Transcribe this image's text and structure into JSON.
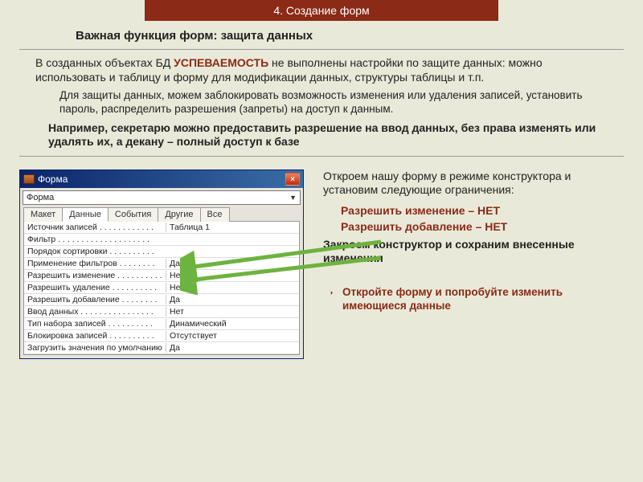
{
  "header": {
    "title": "4. Создание форм"
  },
  "title": "Важная функция форм: защита данных",
  "para1_a": "В созданных объектах БД ",
  "para1_hl": "УСПЕВАЕМОСТЬ",
  "para1_b": " не выполнены настройки по защите данных: можно использовать и таблицу и форму для модификации данных, структуры таблицы и т.п.",
  "para2": "Для защиты данных, можем заблокировать возможность изменения или удаления записей, установить пароль, распределить разрешения (запреты) на доступ к данным.",
  "para3": "Например, секретарю можно предоставить разрешение на ввод данных, без права изменять или удалять их, а декану – полный доступ к базе",
  "right": {
    "line1": "Откроем нашу форму в режиме конструктора и установим следующие ограничения:",
    "opt1": "Разрешить изменение – НЕТ",
    "opt2": "Разрешить добавление – НЕТ",
    "line2": "Закроем конструктор и сохраним внесенные изменения",
    "note": "Откройте форму и попробуйте изменить имеющиеся данные"
  },
  "window": {
    "title": "Форма",
    "close": "×",
    "dropdown_value": "Форма",
    "tabs": [
      "Макет",
      "Данные",
      "События",
      "Другие",
      "Все"
    ],
    "active_tab": 1,
    "props": [
      {
        "label": "Источник записей . . . . . . . . . . . .",
        "value": "Таблица 1"
      },
      {
        "label": "Фильтр . . . . . . . . . . . . . . . . . . . .",
        "value": ""
      },
      {
        "label": "Порядок сортировки . . . . . . . . . .",
        "value": ""
      },
      {
        "label": "Применение фильтров . . . . . . . .",
        "value": "Да"
      },
      {
        "label": "Разрешить изменение . . . . . . . . . .",
        "value": "Нет"
      },
      {
        "label": "Разрешить удаление . . . . . . . . . .",
        "value": "Нет"
      },
      {
        "label": "Разрешить добавление . . . . . . . .",
        "value": "Да"
      },
      {
        "label": "Ввод данных . . . . . . . . . . . . . . . .",
        "value": "Нет"
      },
      {
        "label": "Тип набора записей . . . . . . . . . .",
        "value": "Динамический"
      },
      {
        "label": "Блокировка записей . . . . . . . . . .",
        "value": "Отсутствует"
      },
      {
        "label": "Загрузить значения по умолчанию . .",
        "value": "Да"
      }
    ]
  }
}
